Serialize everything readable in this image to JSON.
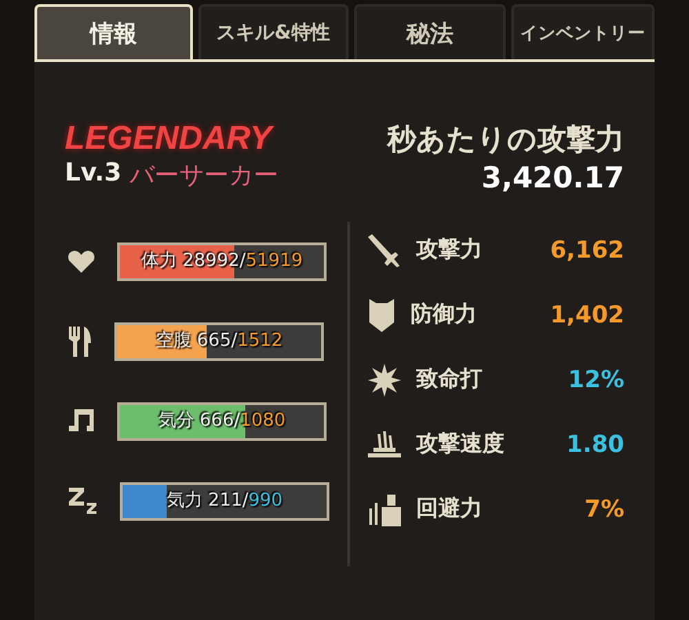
{
  "tabs": [
    {
      "label": "情報",
      "selected": true
    },
    {
      "label": "スキル&特性",
      "selected": false
    },
    {
      "label": "秘法",
      "selected": false
    },
    {
      "label": "インベントリー",
      "selected": false
    }
  ],
  "header": {
    "rarity": "LEGENDARY",
    "level": "Lv.3",
    "class_name": "バーサーカー",
    "dps_label": "秒あたりの攻撃力",
    "dps_value": "3,420.17"
  },
  "gauges": [
    {
      "reading": "体力 28992/",
      "max": {
        "text": "51919",
        "color": "#f59a2a"
      },
      "level": 0.558,
      "color": "#e8624a"
    },
    {
      "reading": "空腹 665/",
      "max": {
        "text": "1512",
        "color": "#f59a2a"
      },
      "level": 0.44,
      "color": "#f5a24e"
    },
    {
      "reading": "気分 666/",
      "max": {
        "text": "1080",
        "color": "#f59a2a"
      },
      "level": 0.617,
      "color": "#6cbd6c"
    },
    {
      "reading": "気力 211/",
      "max": {
        "text": "990",
        "color": "#3cc0e0"
      },
      "level": 0.213,
      "color": "#3f87cf"
    }
  ],
  "stats": [
    {
      "label": "攻撃力",
      "value": "6,162",
      "color": "#f59a2a"
    },
    {
      "label": "防御力",
      "value": "1,402",
      "color": "#f59a2a"
    },
    {
      "label": "致命打",
      "value": "12%",
      "color": "#3cc0e0"
    },
    {
      "label": "攻撃速度",
      "value": "1.80",
      "color": "#3cc0e0"
    },
    {
      "label": "回避力",
      "value": "7%",
      "color": "#f59a2a"
    }
  ]
}
